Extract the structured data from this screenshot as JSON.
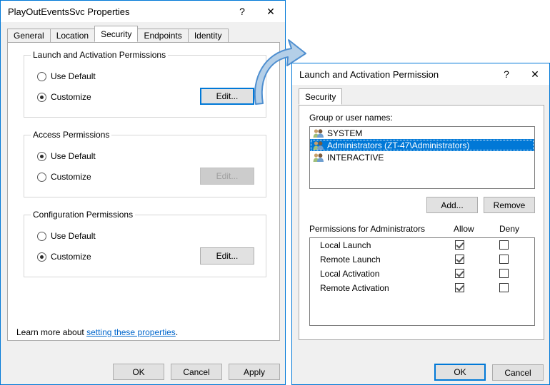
{
  "properties_dialog": {
    "title": "PlayOutEventsSvc Properties",
    "help_icon": "?",
    "close_icon": "✕",
    "tabs": [
      {
        "label": "General",
        "active": false
      },
      {
        "label": "Location",
        "active": false
      },
      {
        "label": "Security",
        "active": true
      },
      {
        "label": "Endpoints",
        "active": false
      },
      {
        "label": "Identity",
        "active": false
      }
    ],
    "groups": [
      {
        "title": "Launch and Activation Permissions",
        "use_default_label": "Use Default",
        "customize_label": "Customize",
        "selected": "customize",
        "edit_label": "Edit...",
        "edit_enabled": true,
        "edit_focused": true
      },
      {
        "title": "Access Permissions",
        "use_default_label": "Use Default",
        "customize_label": "Customize",
        "selected": "use_default",
        "edit_label": "Edit...",
        "edit_enabled": false,
        "edit_focused": false
      },
      {
        "title": "Configuration Permissions",
        "use_default_label": "Use Default",
        "customize_label": "Customize",
        "selected": "customize",
        "edit_label": "Edit...",
        "edit_enabled": true,
        "edit_focused": false
      }
    ],
    "learn_more_prefix": "Learn more about ",
    "learn_more_link": "setting these properties",
    "learn_more_suffix": ".",
    "buttons": {
      "ok": "OK",
      "cancel": "Cancel",
      "apply": "Apply"
    }
  },
  "permission_dialog": {
    "title": "Launch and Activation Permission",
    "help_icon": "?",
    "close_icon": "✕",
    "tabs": [
      {
        "label": "Security",
        "active": true
      }
    ],
    "group_list_label": "Group or user names:",
    "group_list": [
      {
        "name": "SYSTEM",
        "selected": false
      },
      {
        "name": "Administrators (ZT-47\\Administrators)",
        "selected": true
      },
      {
        "name": "INTERACTIVE",
        "selected": false
      }
    ],
    "add_label": "Add...",
    "remove_label": "Remove",
    "permissions_header": "Permissions for Administrators",
    "allow_header": "Allow",
    "deny_header": "Deny",
    "permissions": [
      {
        "name": "Local Launch",
        "allow": true,
        "deny": false
      },
      {
        "name": "Remote Launch",
        "allow": true,
        "deny": false
      },
      {
        "name": "Local Activation",
        "allow": true,
        "deny": false
      },
      {
        "name": "Remote Activation",
        "allow": true,
        "deny": false
      }
    ],
    "buttons": {
      "ok": "OK",
      "cancel": "Cancel"
    }
  },
  "annotation": {
    "arrow_color": "#4f8fd0",
    "arrow_fill": "#b4cfe8"
  },
  "colors": {
    "accent": "#0078d7",
    "window_bg": "#f0f0f0",
    "panel_bg": "#ffffff",
    "link": "#0066cc"
  }
}
